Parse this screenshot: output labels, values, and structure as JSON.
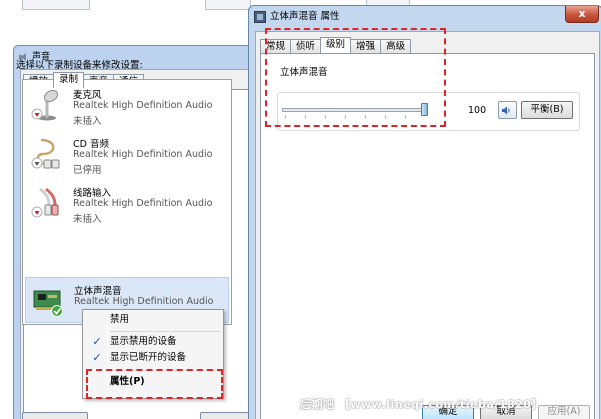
{
  "colors": {
    "highlight_dash": "#e0232a",
    "selection_bg": "#dbe7f6",
    "title_bar": "#c3d7ef",
    "close_button": "#c8543c"
  },
  "sound_window": {
    "title": "声音",
    "tabs": [
      "播放",
      "录制",
      "声音",
      "通信"
    ],
    "active_tab": "录制",
    "instruction": "选择以下录制设备来修改设置:",
    "devices": [
      {
        "name": "麦克风",
        "driver": "Realtek High Definition Audio",
        "status": "未插入",
        "icon": "microphone-icon",
        "badge": "red-down-arrow"
      },
      {
        "name": "CD 音频",
        "driver": "Realtek High Definition Audio",
        "status": "已停用",
        "icon": "cd-audio-cable-icon",
        "badge": "gray-down-arrow"
      },
      {
        "name": "线路输入",
        "driver": "Realtek High Definition Audio",
        "status": "未插入",
        "icon": "line-in-cable-icon",
        "badge": "red-down-arrow"
      },
      {
        "name": "立体声混音",
        "driver": "Realtek High Definition Audio",
        "status": "",
        "icon": "sound-card-icon",
        "badge": "green-check",
        "selected": true
      }
    ]
  },
  "context_menu": {
    "items": [
      {
        "label": "禁用",
        "checked": false
      },
      {
        "label": "显示禁用的设备",
        "checked": true
      },
      {
        "label": "显示已断开的设备",
        "checked": true
      },
      {
        "label": "属性(P)",
        "checked": false,
        "bold": true
      }
    ]
  },
  "properties_dialog": {
    "title": "立体声混音 属性",
    "close_symbol": "x",
    "tabs": [
      "常规",
      "侦听",
      "级别",
      "增强",
      "高级"
    ],
    "active_tab": "级别",
    "level_group_label": "立体声混音",
    "level_value": "100",
    "level_fraction": 1.0,
    "balance_label": "平衡(B)",
    "buttons": {
      "ok": "确定",
      "cancel": "取消",
      "apply": "应用(A)"
    }
  },
  "watermark": "后期吧 【www.lineqi.com/tieba/1820】"
}
